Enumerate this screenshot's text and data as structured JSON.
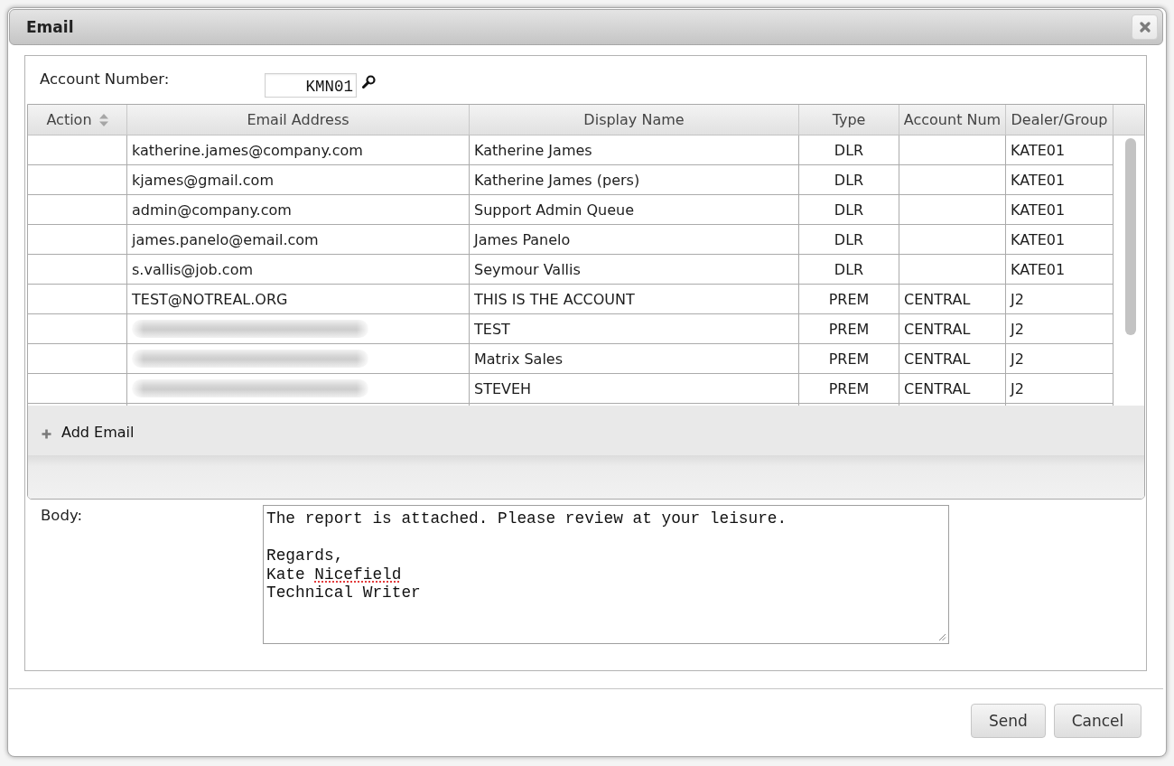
{
  "window": {
    "title": "Email"
  },
  "account": {
    "label": "Account Number:",
    "value": "KMN01"
  },
  "table": {
    "columns": [
      {
        "label": "Action",
        "sortable": true
      },
      {
        "label": "Email Address",
        "sortable": false
      },
      {
        "label": "Display Name",
        "sortable": false
      },
      {
        "label": "Type",
        "sortable": false
      },
      {
        "label": "Account Num",
        "sortable": false
      },
      {
        "label": "Dealer/Group",
        "sortable": false
      }
    ],
    "rows": [
      {
        "email": "katherine.james@company.com",
        "blurred": false,
        "display_name": "Katherine James",
        "type": "DLR",
        "dealer_group": "KATE01"
      },
      {
        "email": "kjames@gmail.com",
        "blurred": false,
        "display_name": "Katherine James (pers)",
        "type": "DLR",
        "dealer_group": "KATE01"
      },
      {
        "email": "admin@company.com",
        "blurred": false,
        "display_name": "Support Admin Queue",
        "type": "DLR",
        "dealer_group": "KATE01"
      },
      {
        "email": "james.panelo@email.com",
        "blurred": false,
        "display_name": "James Panelo",
        "type": "DLR",
        "dealer_group": "KATE01"
      },
      {
        "email": "s.vallis@job.com",
        "blurred": false,
        "display_name": "Seymour Vallis",
        "type": "DLR",
        "dealer_group": "KATE01"
      },
      {
        "email": "TEST@NOTREAL.ORG",
        "blurred": false,
        "display_name": "THIS IS THE ACCOUNT",
        "type": "PREM",
        "account_num": "CENTRAL",
        "dealer_group": "J2"
      },
      {
        "blurred": true,
        "display_name": "TEST",
        "type": "PREM",
        "account_num": "CENTRAL",
        "dealer_group": "J2"
      },
      {
        "blurred": true,
        "display_name": "Matrix Sales",
        "type": "PREM",
        "account_num": "CENTRAL",
        "dealer_group": "J2"
      },
      {
        "blurred": true,
        "display_name": "STEVEH",
        "type": "PREM",
        "account_num": "CENTRAL",
        "dealer_group": "J2"
      }
    ]
  },
  "toolbar": {
    "add_label": "Add Email"
  },
  "body": {
    "label": "Body:",
    "segments": [
      {
        "text": "The report is attached. Please review at your leisure.\n\nRegards,\nKate ",
        "misspelled": false
      },
      {
        "text": "Nicefield",
        "misspelled": true
      },
      {
        "text": "\nTechnical Writer",
        "misspelled": false
      }
    ]
  },
  "buttons": [
    "Send",
    "Cancel"
  ]
}
